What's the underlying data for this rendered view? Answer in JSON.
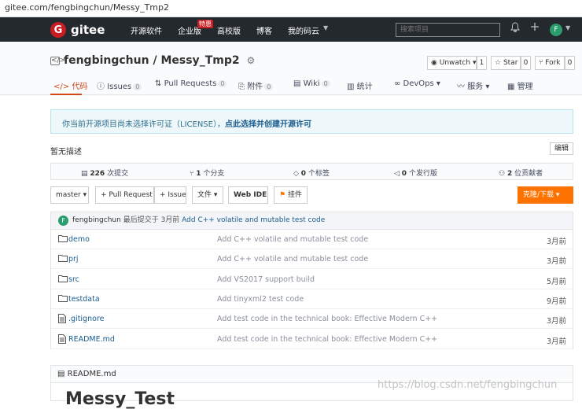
{
  "url": "gitee.com/fengbingchun/Messy_Tmp2",
  "nav": {
    "logo_letter": "G",
    "logo_text": "gitee",
    "items": [
      "开源软件",
      "企业版",
      "高校版",
      "博客",
      "我的码云"
    ],
    "badge": "特惠",
    "search_placeholder": "搜索项目",
    "avatar_letter": "F"
  },
  "repo": {
    "owner": "fengbingchun",
    "separator": "/",
    "name": "Messy_Tmp2",
    "unwatch_label": "Unwatch",
    "unwatch_count": "1",
    "star_label": "Star",
    "star_count": "0",
    "fork_label": "Fork",
    "fork_count": "0"
  },
  "tabs": [
    {
      "label": "代码",
      "count": ""
    },
    {
      "label": "Issues",
      "count": "0"
    },
    {
      "label": "Pull Requests",
      "count": "0"
    },
    {
      "label": "附件",
      "count": "0"
    },
    {
      "label": "Wiki",
      "count": "0"
    },
    {
      "label": "统计",
      "count": ""
    },
    {
      "label": "DevOps",
      "count": ""
    },
    {
      "label": "服务",
      "count": ""
    },
    {
      "label": "管理",
      "count": ""
    }
  ],
  "notice": {
    "text": "你当前开源项目尚未选择许可证（LICENSE），",
    "link": "点此选择并创建开源许可"
  },
  "description": "暂无描述",
  "edit_label": "编辑",
  "stats": {
    "commits": "226",
    "commits_label": "次提交",
    "branches": "1",
    "branches_label": "个分支",
    "tags": "0",
    "tags_label": "个标签",
    "releases": "0",
    "releases_label": "个发行版",
    "contributors": "2",
    "contributors_label": "位贡献者"
  },
  "toolbar": {
    "branch": "master",
    "pull_request": "+ Pull Request",
    "issue": "+ Issue",
    "file": "文件",
    "webide": "Web IDE",
    "plugin": "挂件",
    "clone": "克隆/下载"
  },
  "last_commit": {
    "avatar_letter": "F",
    "user": "fengbingchun",
    "meta": "最后提交于 3月前",
    "message": "Add C++ volatile and mutable test code"
  },
  "files": [
    {
      "name": "demo",
      "type": "folder",
      "message": "Add C++ volatile and mutable test code",
      "time": "3月前"
    },
    {
      "name": "prj",
      "type": "folder",
      "message": "Add C++ volatile and mutable test code",
      "time": "3月前"
    },
    {
      "name": "src",
      "type": "folder",
      "message": "Add VS2017 support build",
      "time": "5月前"
    },
    {
      "name": "testdata",
      "type": "folder",
      "message": "Add tinyxml2 test code",
      "time": "9月前"
    },
    {
      "name": ".gitignore",
      "type": "file",
      "message": "Add test code in the technical book: Effective Modern C++",
      "time": "3月前"
    },
    {
      "name": "README.md",
      "type": "file",
      "message": "Add test code in the technical book: Effective Modern C++",
      "time": "3月前"
    }
  ],
  "readme": {
    "title": "README.md",
    "heading": "Messy_Test"
  },
  "watermark": "https://blog.csdn.net/fengbingchun"
}
